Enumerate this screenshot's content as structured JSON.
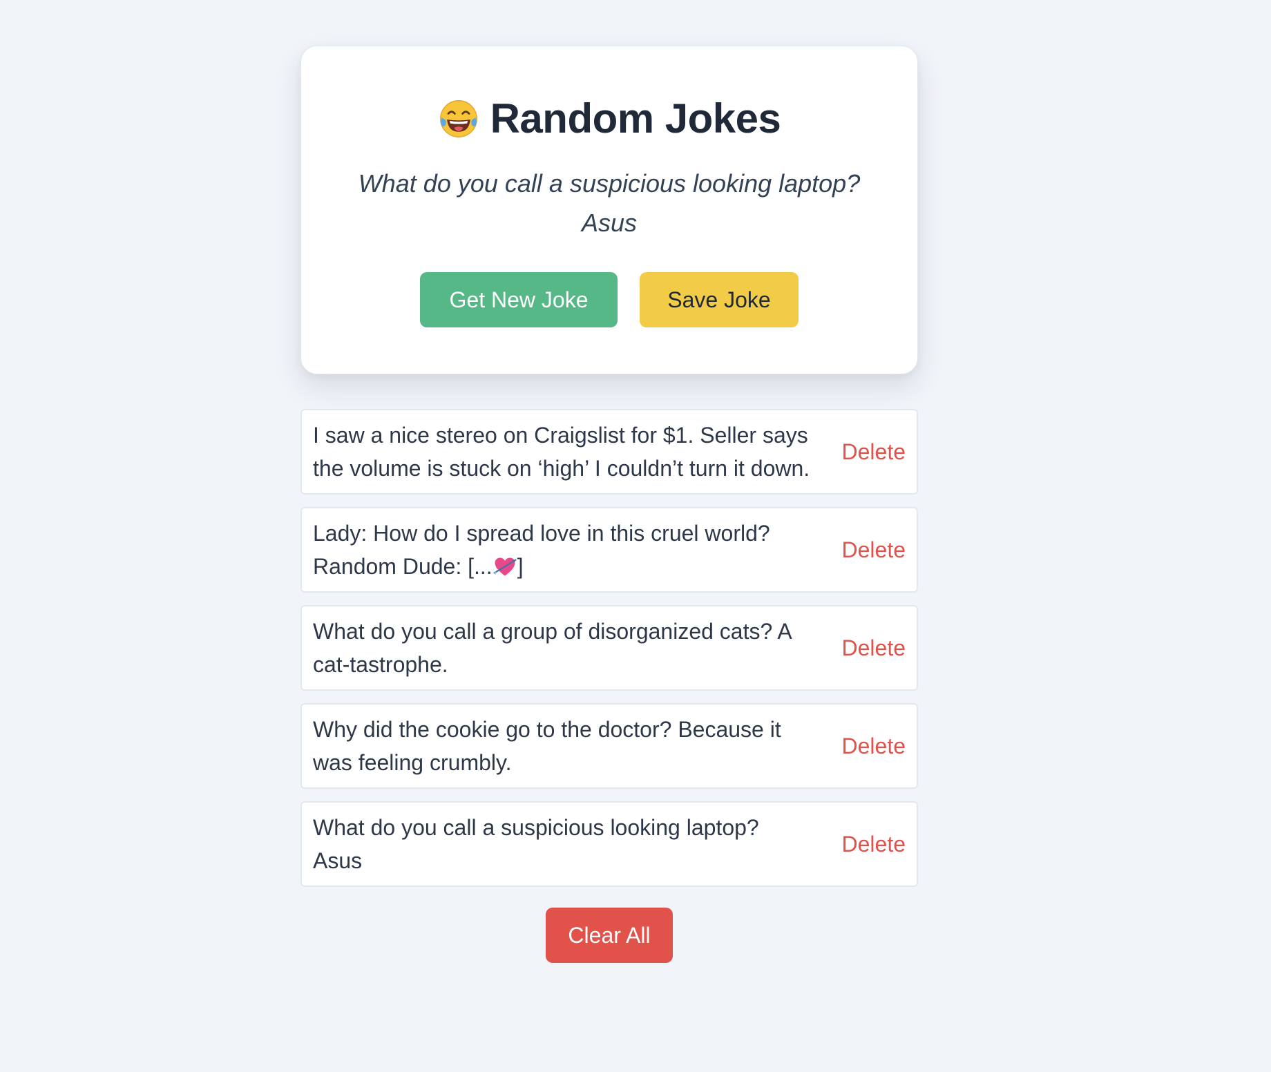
{
  "header": {
    "emoji_icon": "laughing-tears-emoji-icon",
    "title": "Random Jokes"
  },
  "current_joke": {
    "line1": "What do you call a suspicious looking laptop?",
    "line2": "Asus"
  },
  "actions": {
    "get_new_label": "Get New Joke",
    "save_label": "Save Joke"
  },
  "saved_jokes": [
    {
      "text": "I saw a nice stereo on Craigslist for $1. Seller says the volume is stuck on ‘high’ I couldn’t turn it down.",
      "delete_label": "Delete"
    },
    {
      "text_before": "Lady: How do I spread love in this cruel world? Random Dude: [...",
      "text_after": "]",
      "icon": "heart-with-arrow-icon",
      "delete_label": "Delete"
    },
    {
      "text": "What do you call a group of disorganized cats? A cat-tastrophe.",
      "delete_label": "Delete"
    },
    {
      "text": "Why did the cookie go to the doctor? Because it was feeling crumbly.",
      "delete_label": "Delete"
    },
    {
      "text": "What do you call a suspicious looking laptop? Asus",
      "delete_label": "Delete"
    }
  ],
  "footer": {
    "clear_label": "Clear All"
  },
  "colors": {
    "background": "#f1f4f9",
    "green_button": "#55b886",
    "yellow_button": "#f2cc47",
    "red": "#e0524a",
    "title_text": "#1f2937"
  }
}
